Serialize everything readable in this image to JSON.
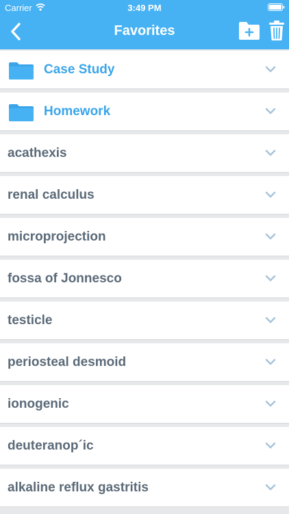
{
  "status_bar": {
    "carrier": "Carrier",
    "time": "3:49 PM"
  },
  "header": {
    "title": "Favorites",
    "back_icon": "chevron-left-icon",
    "new_folder_icon": "folder-plus-icon",
    "trash_icon": "trash-icon",
    "background_color": "#47b2f3"
  },
  "folders": [
    {
      "label": "Case Study",
      "icon": "folder-icon"
    },
    {
      "label": "Homework",
      "icon": "folder-icon"
    }
  ],
  "terms": [
    {
      "label": "acathexis"
    },
    {
      "label": "renal calculus"
    },
    {
      "label": "microprojection"
    },
    {
      "label": "fossa of Jonnesco"
    },
    {
      "label": "testicle"
    },
    {
      "label": "periosteal desmoid"
    },
    {
      "label": "ionogenic"
    },
    {
      "label": "deuteranop´ic"
    },
    {
      "label": "alkaline reflux gastritis"
    }
  ],
  "colors": {
    "folder_text": "#3aa5e8",
    "term_text": "#5b6a78",
    "chevron": "#a9c4da"
  }
}
